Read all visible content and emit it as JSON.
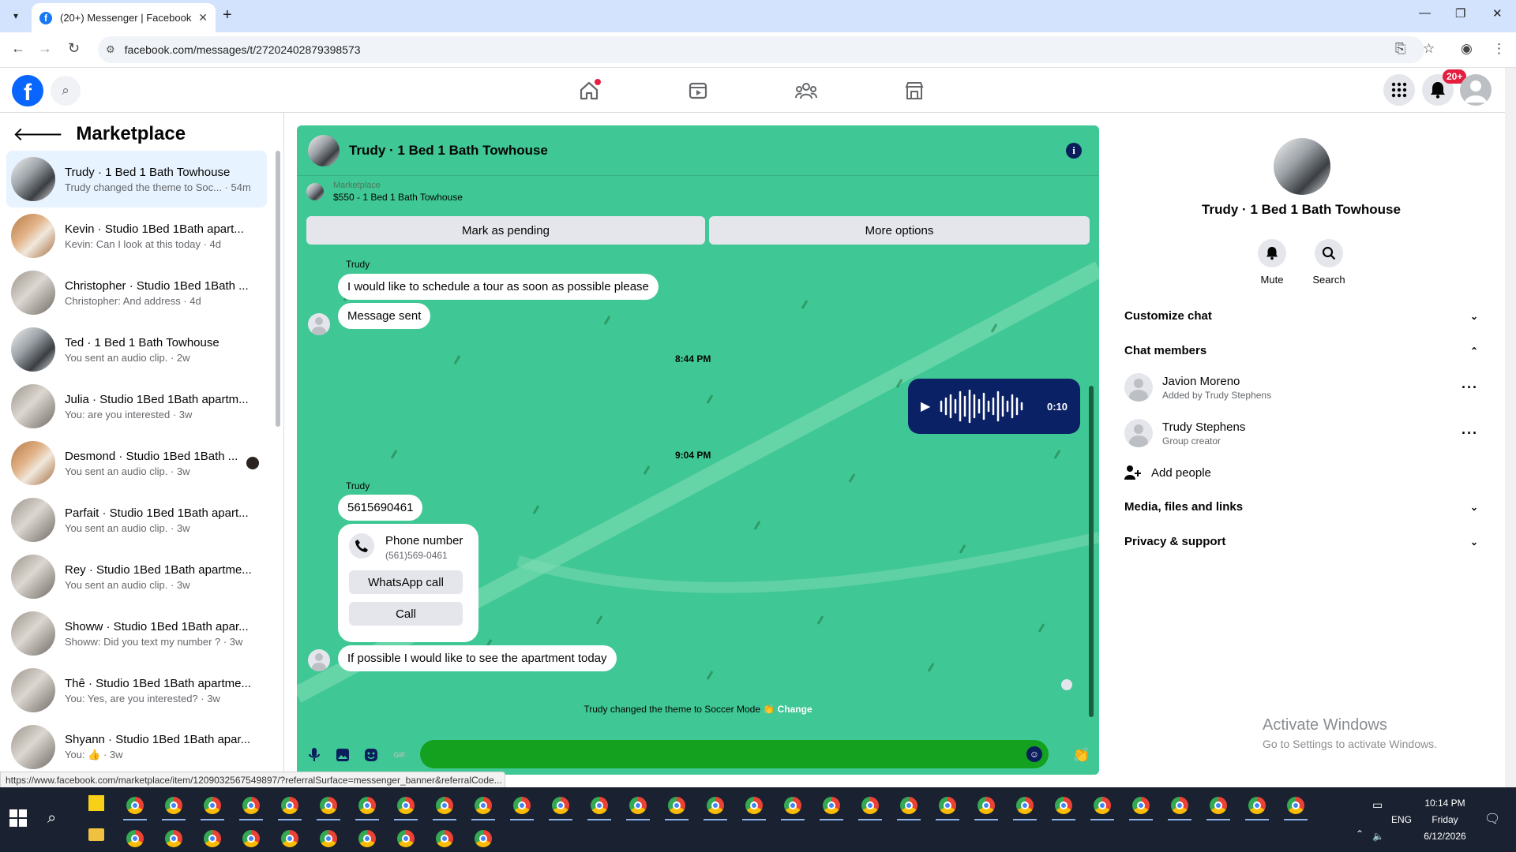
{
  "browser": {
    "tab_title": "(20+) Messenger | Facebook",
    "url": "facebook.com/messages/t/27202402879398573",
    "status_url": "https://www.facebook.com/marketplace/item/1209032567549897/?referralSurface=messenger_banner&referralCode..."
  },
  "header": {
    "notification_badge": "20+"
  },
  "left": {
    "title": "Marketplace",
    "conversations": [
      {
        "name": "Trudy · 1 Bed 1 Bath Towhouse",
        "preview": "Trudy changed the theme to Soc... · 54m"
      },
      {
        "name": "Kevin · Studio 1Bed 1Bath apart...",
        "preview": "Kevin: Can I look at this today · 4d"
      },
      {
        "name": "Christopher · Studio 1Bed 1Bath ...",
        "preview": "Christopher: And address · 4d"
      },
      {
        "name": "Ted · 1 Bed 1 Bath Towhouse",
        "preview": "You sent an audio clip. · 2w"
      },
      {
        "name": "Julia · Studio 1Bed 1Bath apartm...",
        "preview": "You: are you interested · 3w"
      },
      {
        "name": "Desmond · Studio 1Bed 1Bath ...",
        "preview": "You sent an audio clip. · 3w"
      },
      {
        "name": "Parfait · Studio 1Bed 1Bath apart...",
        "preview": "You sent an audio clip. · 3w"
      },
      {
        "name": "Rey · Studio 1Bed 1Bath apartme...",
        "preview": "You sent an audio clip. · 3w"
      },
      {
        "name": "Showw · Studio 1Bed 1Bath apar...",
        "preview": "Showw: Did you text my number ? · 3w"
      },
      {
        "name": "Thê · Studio 1Bed 1Bath apartme...",
        "preview": "You: Yes, are you interested? · 3w"
      },
      {
        "name": "Shyann · Studio 1Bed 1Bath apar...",
        "preview": "You: 👍 · 3w"
      }
    ]
  },
  "chat": {
    "title": "Trudy · 1 Bed 1 Bath Towhouse",
    "listing_label": "Marketplace",
    "listing_detail": "$550 - 1 Bed 1 Bath Towhouse",
    "mark_pending": "Mark as pending",
    "more_options": "More options",
    "sender_1": "Trudy",
    "msg_1": "I would like to schedule a tour as soon as possible please",
    "msg_2": "Message sent",
    "time_1": "8:44 PM",
    "audio_duration": "0:10",
    "time_2": "9:04 PM",
    "sender_2": "Trudy",
    "msg_3": "5615690461",
    "phone_title": "Phone number",
    "phone_sub": "(561)569-0461",
    "whatsapp_call": "WhatsApp call",
    "call": "Call",
    "msg_4": "If possible I would like to see the apartment today",
    "theme_text": "Trudy changed the theme to Soccer Mode 👏",
    "theme_change": "Change"
  },
  "right": {
    "name": "Trudy · 1 Bed 1 Bath Towhouse",
    "mute": "Mute",
    "search": "Search",
    "customize": "Customize chat",
    "members": "Chat members",
    "member_1_name": "Javion Moreno",
    "member_1_sub": "Added by Trudy Stephens",
    "member_2_name": "Trudy Stephens",
    "member_2_sub": "Group creator",
    "add_people": "Add people",
    "media": "Media, files and links",
    "privacy": "Privacy & support"
  },
  "watermark": {
    "line1": "Activate Windows",
    "line2": "Go to Settings to activate Windows."
  },
  "taskbar": {
    "lang": "ENG",
    "time": "10:14 PM",
    "day": "Friday",
    "date": "6/12/2026"
  },
  "colors": {
    "chat_theme": "#3fc795",
    "fb_blue": "#0866ff",
    "audio_bubble": "#0a2166"
  }
}
